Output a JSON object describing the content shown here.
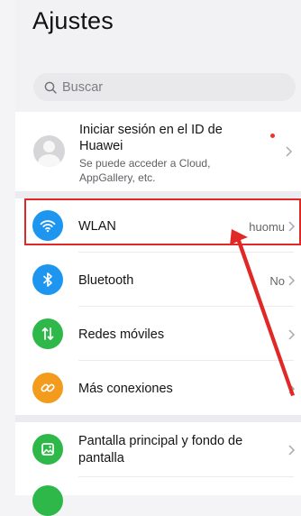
{
  "header": {
    "title": "Ajustes"
  },
  "search": {
    "placeholder": "Buscar"
  },
  "account": {
    "title": "Iniciar sesión en el ID de Huawei",
    "subtitle": "Se puede acceder a Cloud, AppGallery, etc."
  },
  "items": [
    {
      "label": "WLAN",
      "value": "huomu",
      "icon": "wifi-icon",
      "color": "#1e96f0"
    },
    {
      "label": "Bluetooth",
      "value": "No",
      "icon": "bluetooth-icon",
      "color": "#1e96f0"
    },
    {
      "label": "Redes móviles",
      "value": "",
      "icon": "mobile-data-icon",
      "color": "#2fb84a"
    },
    {
      "label": "Más conexiones",
      "value": "",
      "icon": "link-icon",
      "color": "#f39b1d"
    },
    {
      "label": "Pantalla principal y fondo de pantalla",
      "value": "",
      "icon": "wallpaper-icon",
      "color": "#2fb84a"
    }
  ],
  "annotation": {
    "color": "#e02826"
  }
}
